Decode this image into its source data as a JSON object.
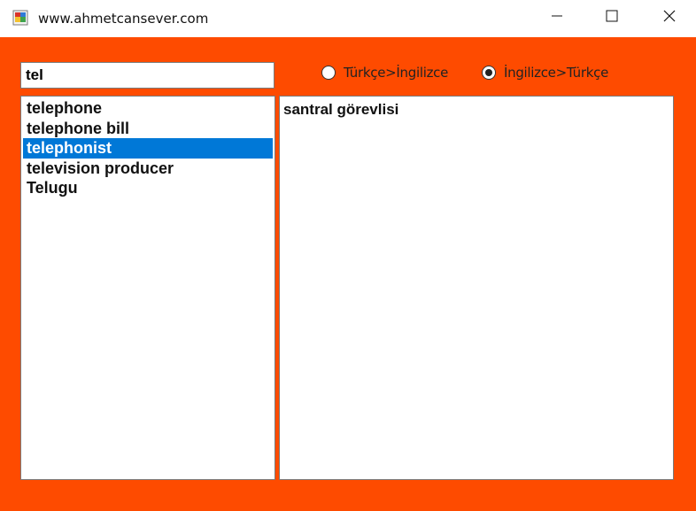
{
  "window": {
    "title": "www.ahmetcansever.com",
    "controls": [
      "minimize-icon",
      "maximize-icon",
      "close-icon"
    ]
  },
  "search": {
    "value": "tel"
  },
  "direction": {
    "options": [
      {
        "label": "Türkçe>İngilizce",
        "selected": false
      },
      {
        "label": "İngilizce>Türkçe",
        "selected": true
      }
    ]
  },
  "results": {
    "items": [
      "telephone",
      "telephone bill",
      "telephonist",
      "television producer",
      "Telugu"
    ],
    "selected_index": 2
  },
  "translation": {
    "text": "santral görevlisi"
  },
  "colors": {
    "client_background": "#fe4b00",
    "selection": "#0078d7"
  }
}
